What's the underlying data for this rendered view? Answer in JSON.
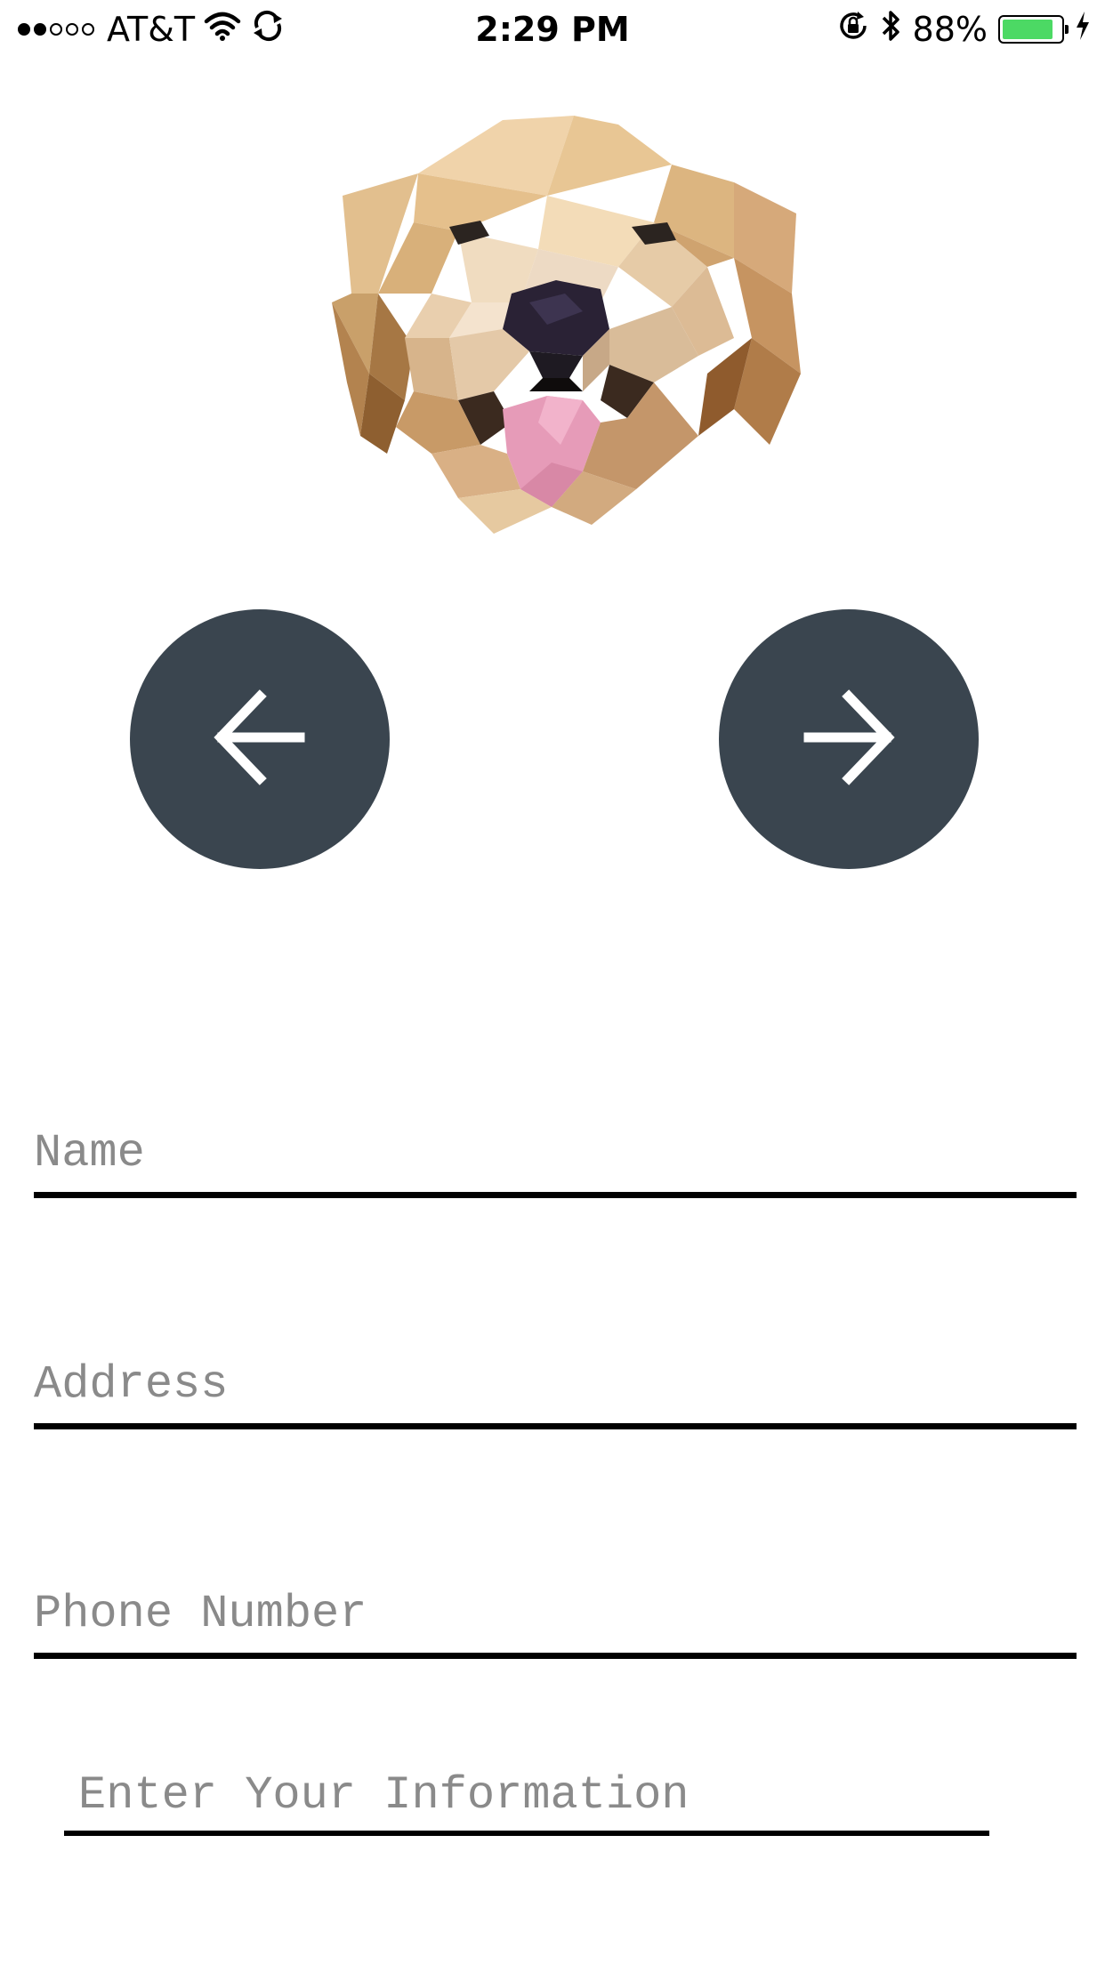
{
  "status_bar": {
    "carrier": "AT&T",
    "time": "2:29 PM",
    "battery_percent": "88%",
    "signal_bars_filled": 2,
    "signal_bars_total": 5,
    "battery_fill": 0.88,
    "battery_color": "#4cd964",
    "icons": [
      "wifi-icon",
      "sync-icon",
      "rotation-lock-icon",
      "bluetooth-icon",
      "battery-icon",
      "charging-bolt-icon"
    ]
  },
  "hero": {
    "image": "low-poly golden retriever dog head"
  },
  "nav": {
    "prev_icon": "arrow-left-icon",
    "next_icon": "arrow-right-icon",
    "button_color": "#3a454f"
  },
  "form": {
    "name": {
      "placeholder": "Name",
      "value": ""
    },
    "address": {
      "placeholder": "Address",
      "value": ""
    },
    "phone": {
      "placeholder": "Phone Number",
      "value": ""
    },
    "info_label": "Enter Your Information"
  }
}
